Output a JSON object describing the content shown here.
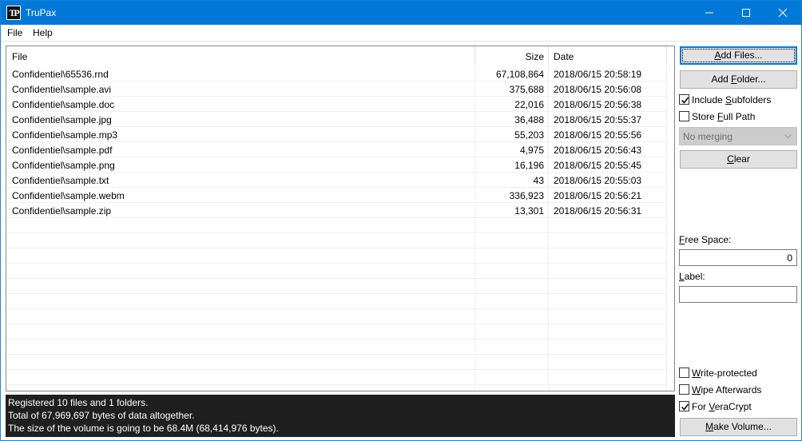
{
  "window": {
    "title": "TruPax",
    "icon": "trupax-logo-icon",
    "icon_text": "TP"
  },
  "menu": {
    "file": "File",
    "help": "Help"
  },
  "table": {
    "headers": {
      "file": "File",
      "size": "Size",
      "date": "Date"
    },
    "rows": [
      {
        "file": "Confidentiel\\65536.rnd",
        "size": "67,108,864",
        "date": "2018/06/15 20:58:19"
      },
      {
        "file": "Confidentiel\\sample.avi",
        "size": "375,688",
        "date": "2018/06/15 20:56:08"
      },
      {
        "file": "Confidentiel\\sample.doc",
        "size": "22,016",
        "date": "2018/06/15 20:56:38"
      },
      {
        "file": "Confidentiel\\sample.jpg",
        "size": "36,488",
        "date": "2018/06/15 20:55:37"
      },
      {
        "file": "Confidentiel\\sample.mp3",
        "size": "55,203",
        "date": "2018/06/15 20:55:56"
      },
      {
        "file": "Confidentiel\\sample.pdf",
        "size": "4,975",
        "date": "2018/06/15 20:56:43"
      },
      {
        "file": "Confidentiel\\sample.png",
        "size": "16,196",
        "date": "2018/06/15 20:55:45"
      },
      {
        "file": "Confidentiel\\sample.txt",
        "size": "43",
        "date": "2018/06/15 20:55:03"
      },
      {
        "file": "Confidentiel\\sample.webm",
        "size": "336,923",
        "date": "2018/06/15 20:56:21"
      },
      {
        "file": "Confidentiel\\sample.zip",
        "size": "13,301",
        "date": "2018/06/15 20:56:31"
      }
    ]
  },
  "status": {
    "line1": "Registered 10 files and 1 folders.",
    "line2": "Total of 67,969,697 bytes of data altogether.",
    "line3": "The size of the volume is going to be 68.4M (68,414,976 bytes)."
  },
  "panel": {
    "add_files": {
      "mnemonic": "A",
      "rest": "dd Files..."
    },
    "add_folder": {
      "pre": "Add ",
      "mnemonic": "F",
      "rest": "older..."
    },
    "include_subfolders": {
      "pre": "Include ",
      "mnemonic": "S",
      "rest": "ubfolders",
      "checked": true
    },
    "store_full_path": {
      "pre": "Store ",
      "mnemonic": "F",
      "rest": "ull Path",
      "checked": false
    },
    "merging": {
      "selected": "No merging",
      "enabled": false
    },
    "clear": {
      "mnemonic": "C",
      "rest": "lear"
    },
    "free_space": {
      "mnemonic": "F",
      "rest": "ree Space:",
      "value": "0"
    },
    "label": {
      "mnemonic": "L",
      "rest": "abel:",
      "value": ""
    },
    "write_protected": {
      "mnemonic": "W",
      "rest": "rite-protected",
      "checked": false
    },
    "wipe_afterwards": {
      "mnemonic": "W",
      "rest": "ipe Afterwards",
      "checked": false
    },
    "for_veracrypt": {
      "pre": "For ",
      "mnemonic": "V",
      "rest": "eraCrypt",
      "checked": true
    },
    "make_volume": {
      "mnemonic": "M",
      "rest": "ake Volume..."
    }
  },
  "colors": {
    "titlebar": "#0078d7",
    "status_bg": "#1f1f1f",
    "focus": "#0078d7"
  }
}
